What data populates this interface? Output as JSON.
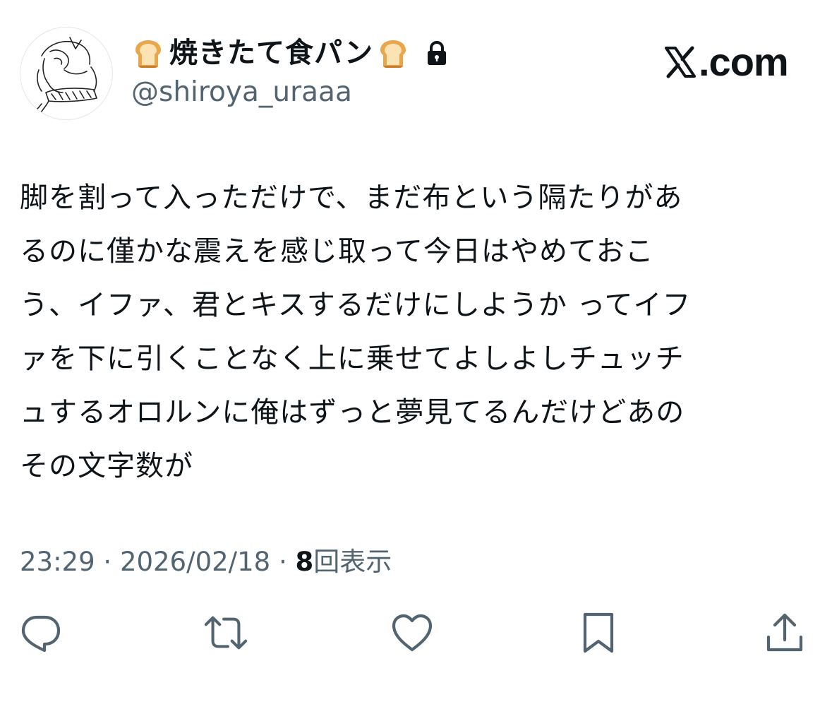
{
  "tweet": {
    "display_name": "焼きたて食パン",
    "name_emoji_left": "bread-icon",
    "name_emoji_right": "bread-icon",
    "protected_icon": "lock-icon",
    "handle": "@shiroya_uraaa",
    "watermark": "X.com",
    "text_lines": [
      "脚を割って入っただけで、まだ布という隔たりがあ",
      "るのに僅かな震えを感じ取って今日はやめておこ",
      "う、イファ、君とキスするだけにしようか ってイフ",
      "ァを下に引くことなく上に乗せてよしよしチュッチ",
      "ュするオロルンに俺はずっと夢見てるんだけどあの",
      "その文字数が"
    ],
    "time": "23:29",
    "separator": "·",
    "date": "2026/02/18",
    "views_count": "8",
    "views_label": "回表示"
  },
  "actions": [
    {
      "name": "reply",
      "icon": "reply-icon"
    },
    {
      "name": "retweet",
      "icon": "retweet-icon"
    },
    {
      "name": "like",
      "icon": "heart-icon"
    },
    {
      "name": "bookmark",
      "icon": "bookmark-icon"
    },
    {
      "name": "share",
      "icon": "share-icon"
    }
  ],
  "colors": {
    "text": "#0f1419",
    "secondary": "#536471",
    "icon": "#536471",
    "background": "#ffffff"
  }
}
